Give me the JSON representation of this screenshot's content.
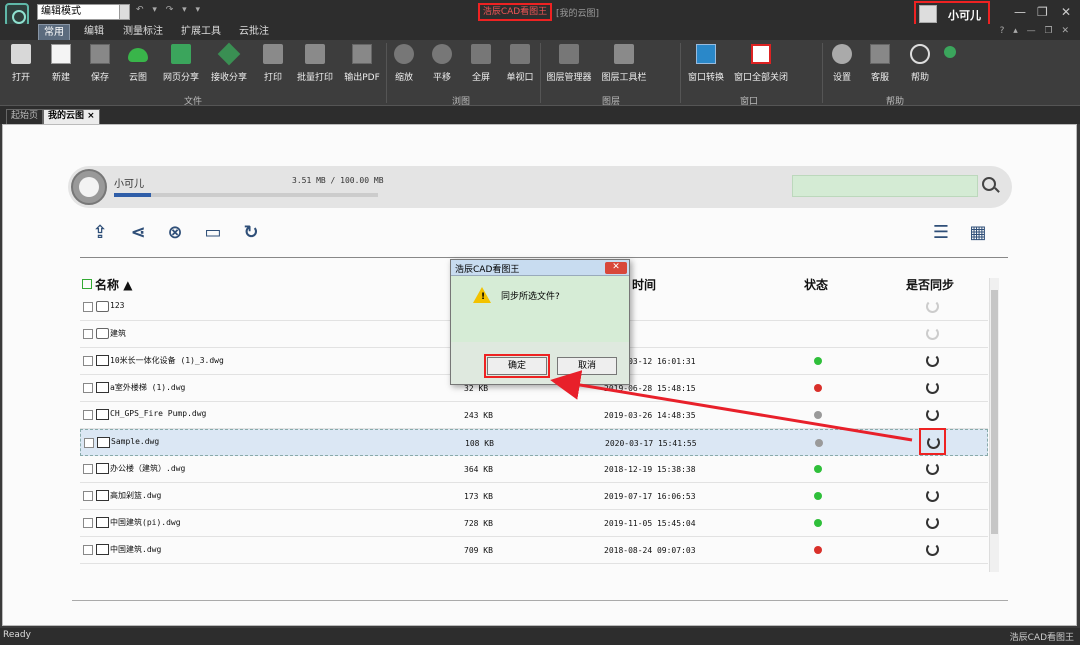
{
  "titlebar": {
    "mode": "编辑模式",
    "app_title": "浩辰CAD看图王",
    "window_title": "[我的云图]",
    "user_name": "小可儿",
    "minimize": "—",
    "restore": "❐",
    "close": "✕"
  },
  "ribbon_tabs": [
    "常用",
    "编辑",
    "测量标注",
    "扩展工具",
    "云批注"
  ],
  "ribbon": {
    "groups": [
      "文件",
      "浏图",
      "图层",
      "窗口",
      "帮助"
    ],
    "buttons": {
      "open": "打开",
      "new": "新建",
      "save": "保存",
      "cloud": "云图",
      "web_share": "网页分享",
      "receive_share": "接收分享",
      "print": "打印",
      "batch_print": "批量打印",
      "export_pdf": "输出PDF",
      "zoom": "缩放",
      "pan": "平移",
      "fullscreen": "全屏",
      "single_view": "单视口",
      "layer_manager": "图层管理器",
      "layer_toolbar": "图层工具栏",
      "window_switch": "窗口转换",
      "close_all": "窗口全部关闭",
      "settings": "设置",
      "support": "客服",
      "help": "帮助"
    }
  },
  "doc_tabs": [
    "起始页",
    "我的云图"
  ],
  "userbar": {
    "name": "小可儿",
    "quota": "3.51 MB / 100.00 MB",
    "quota_fraction": 0.0351
  },
  "table": {
    "headers": {
      "name": "名称",
      "time": "时间",
      "status": "状态",
      "sync": "是否同步"
    },
    "rows": [
      {
        "type": "folder",
        "name": "123",
        "size": "",
        "date": "",
        "status": "",
        "sync": "disabled"
      },
      {
        "type": "folder",
        "name": "建筑",
        "size": "",
        "date": "",
        "status": "",
        "sync": "disabled"
      },
      {
        "type": "dwg",
        "name": "10米长一体化设备 (1)_3.dwg",
        "size": "",
        "date": "2019-03-12 16:01:31",
        "status": "green",
        "sync": "on"
      },
      {
        "type": "dwg",
        "name": "a室外楼梯 (1).dwg",
        "size": "32 KB",
        "date": "2019-06-28 15:48:15",
        "status": "red",
        "sync": "on"
      },
      {
        "type": "dwg",
        "name": "CH_GPS_Fire Pump.dwg",
        "size": "243 KB",
        "date": "2019-03-26 14:48:35",
        "status": "gray",
        "sync": "on"
      },
      {
        "type": "dwg",
        "name": "Sample.dwg",
        "size": "108 KB",
        "date": "2020-03-17 15:41:55",
        "status": "gray",
        "sync": "on",
        "selected": true
      },
      {
        "type": "dwg",
        "name": "办公楼（建筑）.dwg",
        "size": "364 KB",
        "date": "2018-12-19 15:38:38",
        "status": "green",
        "sync": "on"
      },
      {
        "type": "dwg",
        "name": "高加剁篮.dwg",
        "size": "173 KB",
        "date": "2019-07-17 16:06:53",
        "status": "green",
        "sync": "on"
      },
      {
        "type": "dwg",
        "name": "中国建筑(pi).dwg",
        "size": "728 KB",
        "date": "2019-11-05 15:45:04",
        "status": "green",
        "sync": "on"
      },
      {
        "type": "dwg",
        "name": "中国建筑.dwg",
        "size": "709 KB",
        "date": "2018-08-24 09:07:03",
        "status": "red",
        "sync": "on"
      }
    ]
  },
  "dialog": {
    "title": "浩辰CAD看图王",
    "close": "✕",
    "message": "同步所选文件?",
    "warn_mark": "!",
    "ok": "确定",
    "cancel": "取消"
  },
  "status": {
    "text": "Ready",
    "app": "浩辰CAD看图王"
  },
  "colors": {
    "status_green": "#2fbf3a",
    "status_red": "#d9302a",
    "status_gray": "#9a9a9a",
    "highlight": "#e22222"
  }
}
